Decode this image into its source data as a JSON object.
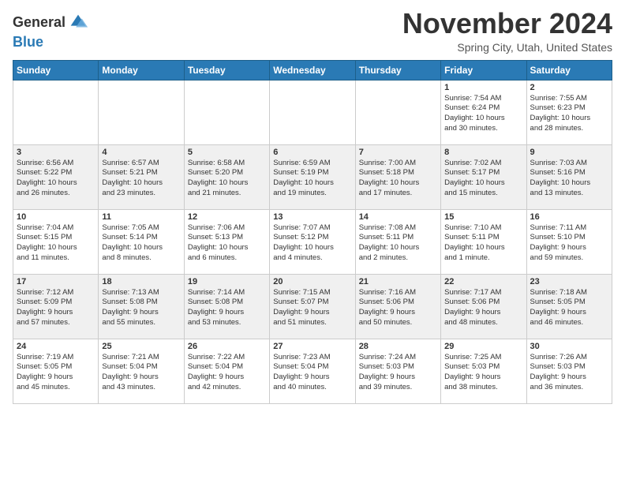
{
  "header": {
    "logo_line1": "General",
    "logo_line2": "Blue",
    "month": "November 2024",
    "location": "Spring City, Utah, United States"
  },
  "weekdays": [
    "Sunday",
    "Monday",
    "Tuesday",
    "Wednesday",
    "Thursday",
    "Friday",
    "Saturday"
  ],
  "weeks": [
    [
      {
        "day": "",
        "info": ""
      },
      {
        "day": "",
        "info": ""
      },
      {
        "day": "",
        "info": ""
      },
      {
        "day": "",
        "info": ""
      },
      {
        "day": "",
        "info": ""
      },
      {
        "day": "1",
        "info": "Sunrise: 7:54 AM\nSunset: 6:24 PM\nDaylight: 10 hours\nand 30 minutes."
      },
      {
        "day": "2",
        "info": "Sunrise: 7:55 AM\nSunset: 6:23 PM\nDaylight: 10 hours\nand 28 minutes."
      }
    ],
    [
      {
        "day": "3",
        "info": "Sunrise: 6:56 AM\nSunset: 5:22 PM\nDaylight: 10 hours\nand 26 minutes."
      },
      {
        "day": "4",
        "info": "Sunrise: 6:57 AM\nSunset: 5:21 PM\nDaylight: 10 hours\nand 23 minutes."
      },
      {
        "day": "5",
        "info": "Sunrise: 6:58 AM\nSunset: 5:20 PM\nDaylight: 10 hours\nand 21 minutes."
      },
      {
        "day": "6",
        "info": "Sunrise: 6:59 AM\nSunset: 5:19 PM\nDaylight: 10 hours\nand 19 minutes."
      },
      {
        "day": "7",
        "info": "Sunrise: 7:00 AM\nSunset: 5:18 PM\nDaylight: 10 hours\nand 17 minutes."
      },
      {
        "day": "8",
        "info": "Sunrise: 7:02 AM\nSunset: 5:17 PM\nDaylight: 10 hours\nand 15 minutes."
      },
      {
        "day": "9",
        "info": "Sunrise: 7:03 AM\nSunset: 5:16 PM\nDaylight: 10 hours\nand 13 minutes."
      }
    ],
    [
      {
        "day": "10",
        "info": "Sunrise: 7:04 AM\nSunset: 5:15 PM\nDaylight: 10 hours\nand 11 minutes."
      },
      {
        "day": "11",
        "info": "Sunrise: 7:05 AM\nSunset: 5:14 PM\nDaylight: 10 hours\nand 8 minutes."
      },
      {
        "day": "12",
        "info": "Sunrise: 7:06 AM\nSunset: 5:13 PM\nDaylight: 10 hours\nand 6 minutes."
      },
      {
        "day": "13",
        "info": "Sunrise: 7:07 AM\nSunset: 5:12 PM\nDaylight: 10 hours\nand 4 minutes."
      },
      {
        "day": "14",
        "info": "Sunrise: 7:08 AM\nSunset: 5:11 PM\nDaylight: 10 hours\nand 2 minutes."
      },
      {
        "day": "15",
        "info": "Sunrise: 7:10 AM\nSunset: 5:11 PM\nDaylight: 10 hours\nand 1 minute."
      },
      {
        "day": "16",
        "info": "Sunrise: 7:11 AM\nSunset: 5:10 PM\nDaylight: 9 hours\nand 59 minutes."
      }
    ],
    [
      {
        "day": "17",
        "info": "Sunrise: 7:12 AM\nSunset: 5:09 PM\nDaylight: 9 hours\nand 57 minutes."
      },
      {
        "day": "18",
        "info": "Sunrise: 7:13 AM\nSunset: 5:08 PM\nDaylight: 9 hours\nand 55 minutes."
      },
      {
        "day": "19",
        "info": "Sunrise: 7:14 AM\nSunset: 5:08 PM\nDaylight: 9 hours\nand 53 minutes."
      },
      {
        "day": "20",
        "info": "Sunrise: 7:15 AM\nSunset: 5:07 PM\nDaylight: 9 hours\nand 51 minutes."
      },
      {
        "day": "21",
        "info": "Sunrise: 7:16 AM\nSunset: 5:06 PM\nDaylight: 9 hours\nand 50 minutes."
      },
      {
        "day": "22",
        "info": "Sunrise: 7:17 AM\nSunset: 5:06 PM\nDaylight: 9 hours\nand 48 minutes."
      },
      {
        "day": "23",
        "info": "Sunrise: 7:18 AM\nSunset: 5:05 PM\nDaylight: 9 hours\nand 46 minutes."
      }
    ],
    [
      {
        "day": "24",
        "info": "Sunrise: 7:19 AM\nSunset: 5:05 PM\nDaylight: 9 hours\nand 45 minutes."
      },
      {
        "day": "25",
        "info": "Sunrise: 7:21 AM\nSunset: 5:04 PM\nDaylight: 9 hours\nand 43 minutes."
      },
      {
        "day": "26",
        "info": "Sunrise: 7:22 AM\nSunset: 5:04 PM\nDaylight: 9 hours\nand 42 minutes."
      },
      {
        "day": "27",
        "info": "Sunrise: 7:23 AM\nSunset: 5:04 PM\nDaylight: 9 hours\nand 40 minutes."
      },
      {
        "day": "28",
        "info": "Sunrise: 7:24 AM\nSunset: 5:03 PM\nDaylight: 9 hours\nand 39 minutes."
      },
      {
        "day": "29",
        "info": "Sunrise: 7:25 AM\nSunset: 5:03 PM\nDaylight: 9 hours\nand 38 minutes."
      },
      {
        "day": "30",
        "info": "Sunrise: 7:26 AM\nSunset: 5:03 PM\nDaylight: 9 hours\nand 36 minutes."
      }
    ]
  ]
}
